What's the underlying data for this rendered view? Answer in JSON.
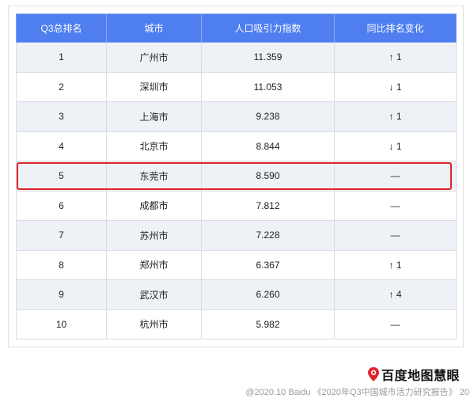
{
  "table": {
    "headers": [
      "Q3总排名",
      "城市",
      "人口吸引力指数",
      "同比排名变化"
    ],
    "rows": [
      {
        "rank": "1",
        "city": "广州市",
        "index": "11.359",
        "change": "↑ 1",
        "trend": "up"
      },
      {
        "rank": "2",
        "city": "深圳市",
        "index": "11.053",
        "change": "↓ 1",
        "trend": "down"
      },
      {
        "rank": "3",
        "city": "上海市",
        "index": "9.238",
        "change": "↑ 1",
        "trend": "up"
      },
      {
        "rank": "4",
        "city": "北京市",
        "index": "8.844",
        "change": "↓ 1",
        "trend": "down"
      },
      {
        "rank": "5",
        "city": "东莞市",
        "index": "8.590",
        "change": "—",
        "trend": "flat"
      },
      {
        "rank": "6",
        "city": "成都市",
        "index": "7.812",
        "change": "—",
        "trend": "flat"
      },
      {
        "rank": "7",
        "city": "苏州市",
        "index": "7.228",
        "change": "—",
        "trend": "flat"
      },
      {
        "rank": "8",
        "city": "郑州市",
        "index": "6.367",
        "change": "↑ 1",
        "trend": "up"
      },
      {
        "rank": "9",
        "city": "武汉市",
        "index": "6.260",
        "change": "↑ 4",
        "trend": "up"
      },
      {
        "rank": "10",
        "city": "杭州市",
        "index": "5.982",
        "change": "—",
        "trend": "flat"
      }
    ],
    "highlighted_rank": "5"
  },
  "colors": {
    "header_bg": "#4e7ef0",
    "row_shade": "#eef1f6",
    "up": "#e0772a",
    "down": "#2e9a3a",
    "highlight_border": "#e0252a"
  },
  "brand": {
    "logo_text": "百度地图慧眼",
    "logo_icon": "map-pin-icon"
  },
  "footer": {
    "source": "@2020.10 Baidu 《2020年Q3中国城市活力研究报告》",
    "page": "20"
  }
}
